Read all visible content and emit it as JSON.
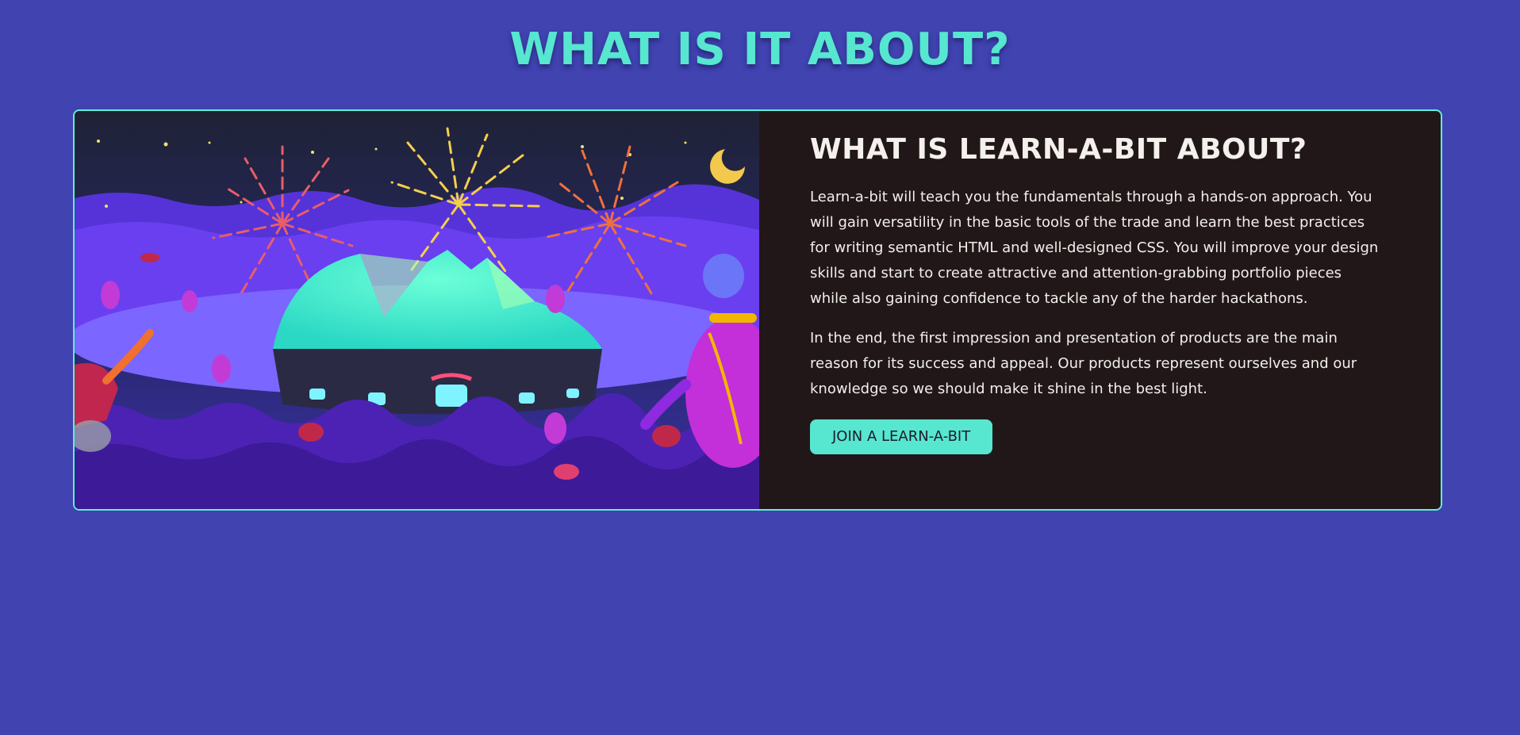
{
  "page_title": "WHAT IS IT ABOUT?",
  "card": {
    "heading": "WHAT IS LEARN-A-BIT ABOUT?",
    "paragraphs": [
      "Learn-a-bit will teach you the fundamentals through a hands-on approach. You will gain versatility in the basic tools of the trade and learn the best practices for writing semantic HTML and well-designed CSS. You will improve your design skills and start to create attractive and attention-grabbing portfolio pieces while also gaining confidence to tackle any of the harder hackathons.",
      "In the end, the first impression and presentation of products are the main reason for its success and appeal. Our products represent ourselves and our knowledge so we should make it shine in the best light."
    ],
    "button_label": "JOIN A LEARN-A-BIT",
    "illustration": "fireworks-arena-illustration"
  },
  "colors": {
    "background": "#4043b0",
    "accent": "#57e6cf",
    "card_background": "#211719",
    "text": "#f2efe9"
  }
}
